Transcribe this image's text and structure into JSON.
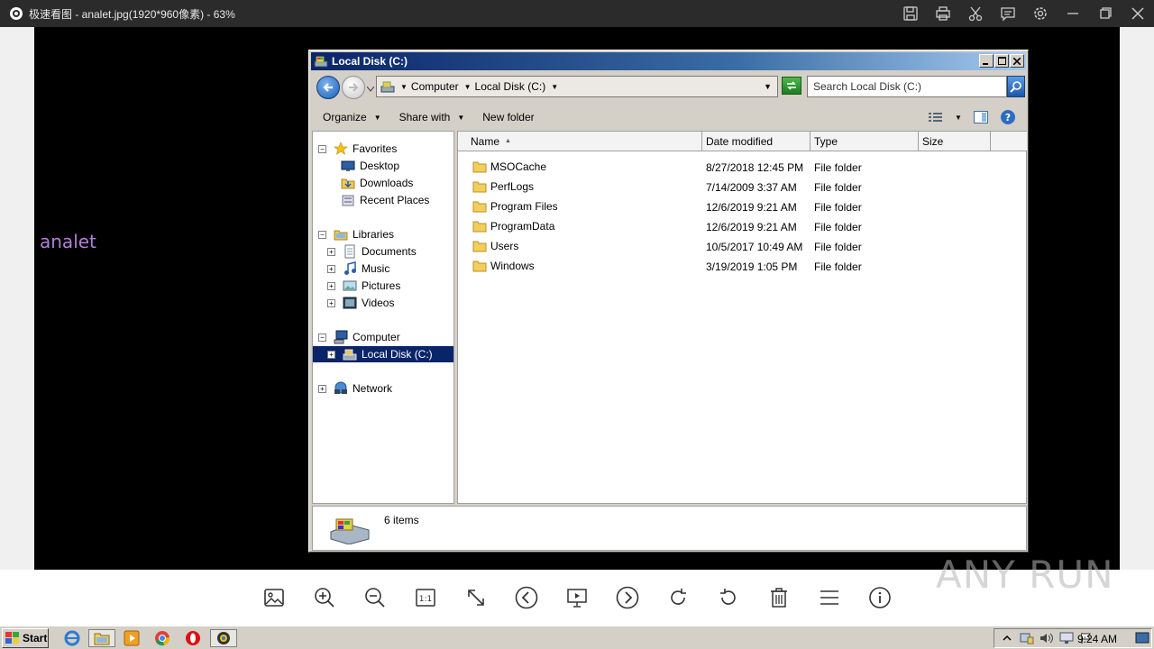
{
  "viewer": {
    "title": "极速看图 - analet.jpg(1920*960像素) - 63%",
    "toolbar_icons": [
      "save-icon",
      "print-icon",
      "cut-icon",
      "comment-icon",
      "settings-icon",
      "minimize-icon",
      "maximize-icon",
      "close-icon"
    ],
    "image_text": "analet",
    "bottom_tools": [
      "image-icon",
      "zoom-in-icon",
      "zoom-out-icon",
      "actual-size-icon",
      "fit-icon",
      "prev-icon",
      "slideshow-icon",
      "next-icon",
      "rotate-right-icon",
      "rotate-left-icon",
      "delete-icon",
      "menu-icon",
      "info-icon"
    ],
    "actual_size_label": "1:1",
    "watermark": "ANY RUN"
  },
  "explorer": {
    "title": "Local Disk (C:)",
    "address": {
      "crumbs": [
        "Computer",
        "Local Disk (C:)"
      ]
    },
    "search": {
      "placeholder": "Search Local Disk (C:)"
    },
    "commands": {
      "organize": "Organize",
      "share_with": "Share with",
      "new_folder": "New folder"
    },
    "nav": {
      "favorites": "Favorites",
      "desktop": "Desktop",
      "downloads": "Downloads",
      "recent_places": "Recent Places",
      "libraries": "Libraries",
      "documents": "Documents",
      "music": "Music",
      "pictures": "Pictures",
      "videos": "Videos",
      "computer": "Computer",
      "local_disk": "Local Disk (C:)",
      "network": "Network"
    },
    "columns": {
      "name": "Name",
      "date": "Date modified",
      "type": "Type",
      "size": "Size"
    },
    "files": [
      {
        "name": "MSOCache",
        "date": "8/27/2018 12:45 PM",
        "type": "File folder"
      },
      {
        "name": "PerfLogs",
        "date": "7/14/2009 3:37 AM",
        "type": "File folder"
      },
      {
        "name": "Program Files",
        "date": "12/6/2019 9:21 AM",
        "type": "File folder"
      },
      {
        "name": "ProgramData",
        "date": "12/6/2019 9:21 AM",
        "type": "File folder"
      },
      {
        "name": "Users",
        "date": "10/5/2017 10:49 AM",
        "type": "File folder"
      },
      {
        "name": "Windows",
        "date": "3/19/2019 1:05 PM",
        "type": "File folder"
      }
    ],
    "status": "6 items"
  },
  "taskbar": {
    "start": "Start",
    "clock": "9:24 AM",
    "apps": [
      "ie-icon",
      "explorer-icon",
      "media-player-icon",
      "chrome-icon",
      "opera-icon",
      "image-viewer-icon"
    ]
  }
}
